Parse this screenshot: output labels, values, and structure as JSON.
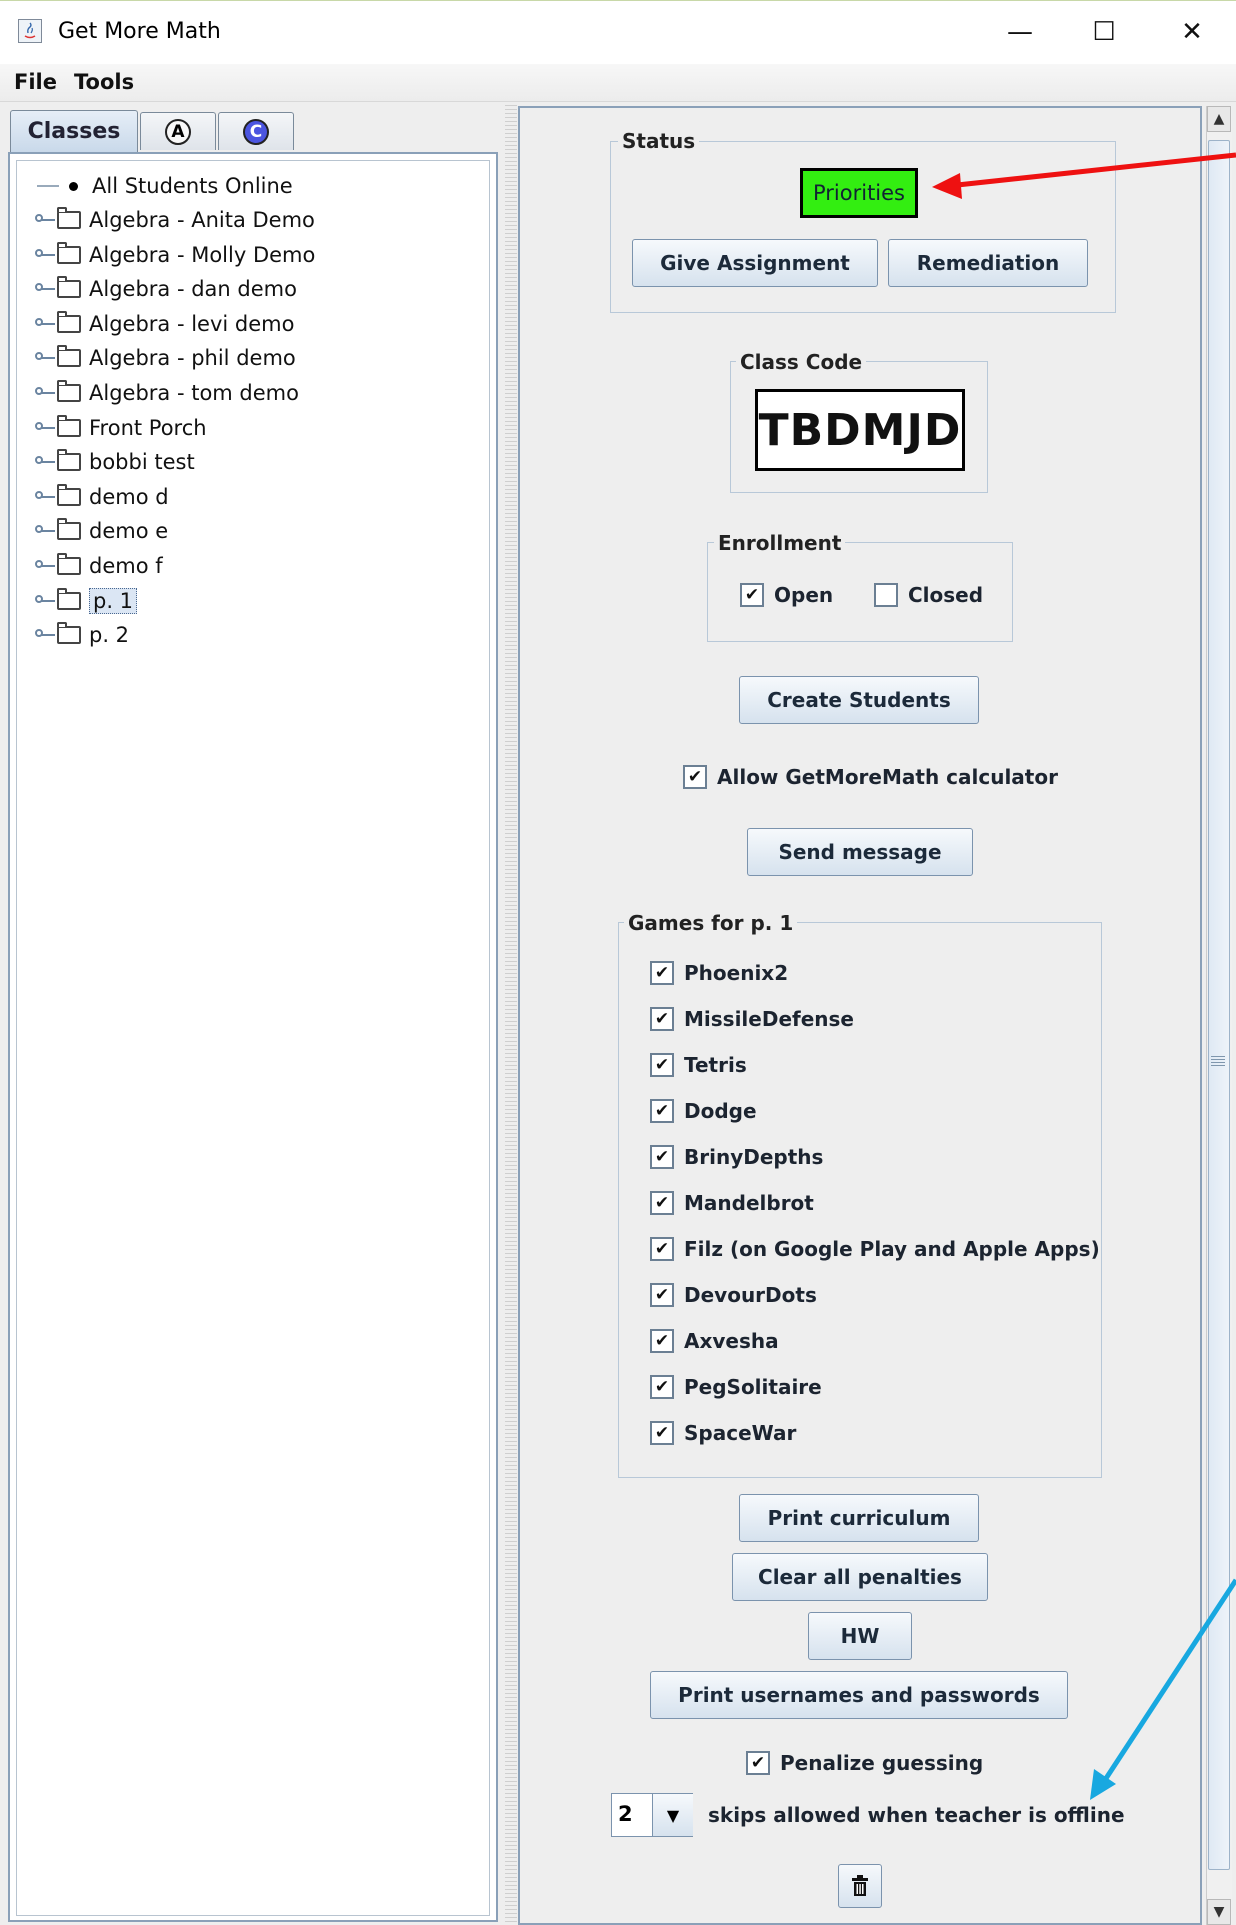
{
  "window": {
    "title": "Get More Math",
    "controls": {
      "minimize": "—",
      "maximize": "☐",
      "close": "✕"
    }
  },
  "menu": [
    "File",
    "Tools"
  ],
  "tabs": {
    "classes": "Classes",
    "a_letter": "A",
    "c_letter": "C"
  },
  "tree": {
    "root": "All Students Online",
    "items": [
      "Algebra - Anita Demo",
      "Algebra - Molly Demo",
      "Algebra - dan demo",
      "Algebra - levi demo",
      "Algebra - phil demo",
      "Algebra - tom demo",
      "Front Porch",
      "bobbi test",
      "demo d",
      "demo e",
      "demo f",
      "p. 1",
      "p. 2"
    ],
    "selected": "p. 1"
  },
  "status": {
    "label": "Status",
    "priorities": "Priorities",
    "priorities_color": "#33ee11",
    "give_assignment": "Give Assignment",
    "remediation": "Remediation"
  },
  "class_code": {
    "label": "Class Code",
    "value": "TBDMJD"
  },
  "enrollment": {
    "label": "Enrollment",
    "open": {
      "label": "Open",
      "checked": true
    },
    "closed": {
      "label": "Closed",
      "checked": false
    }
  },
  "create_students": "Create Students",
  "calculator": {
    "label": "Allow GetMoreMath calculator",
    "checked": true
  },
  "send_message": "Send message",
  "games": {
    "label": "Games for p. 1",
    "items": [
      "Phoenix2",
      "MissileDefense",
      "Tetris",
      "Dodge",
      "BrinyDepths",
      "Mandelbrot",
      "Filz (on Google Play and Apple Apps)",
      "DevourDots",
      "Axvesha",
      "PegSolitaire",
      "SpaceWar"
    ],
    "check_mark": "✔"
  },
  "buttons": {
    "print_curriculum": "Print curriculum",
    "clear_penalties": "Clear all penalties",
    "hw": "HW",
    "print_usernames": "Print usernames and passwords"
  },
  "penalize": {
    "label": "Penalize guessing",
    "checked": true
  },
  "skips": {
    "value": "2",
    "label": "skips allowed when teacher is offline"
  },
  "annotation_colors": {
    "red_arrow": "#ee1111",
    "blue_arrow": "#18a8e0"
  }
}
